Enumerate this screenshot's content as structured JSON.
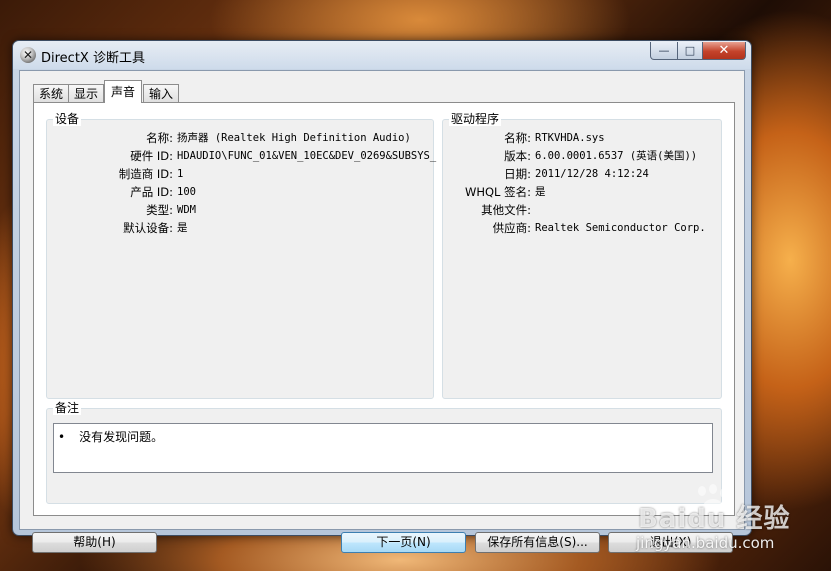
{
  "window": {
    "title": "DirectX 诊断工具",
    "controls": {
      "minimize": "—",
      "maximize": "□",
      "close": "✕"
    }
  },
  "tabs": [
    {
      "label": "系统",
      "active": false
    },
    {
      "label": "显示",
      "active": false
    },
    {
      "label": "声音",
      "active": true
    },
    {
      "label": "输入",
      "active": false
    }
  ],
  "device": {
    "title": "设备",
    "rows": [
      {
        "label": "名称:",
        "value": "扬声器 (Realtek High Definition Audio)"
      },
      {
        "label": "硬件 ID:",
        "value": "HDAUDIO\\FUNC_01&VEN_10EC&DEV_0269&SUBSYS_"
      },
      {
        "label": "制造商 ID:",
        "value": "1"
      },
      {
        "label": "产品 ID:",
        "value": "100"
      },
      {
        "label": "类型:",
        "value": "WDM"
      },
      {
        "label": "默认设备:",
        "value": "是"
      }
    ]
  },
  "driver": {
    "title": "驱动程序",
    "rows": [
      {
        "label": "名称:",
        "value": "RTKVHDA.sys"
      },
      {
        "label": "版本:",
        "value": "6.00.0001.6537 (英语(美国))"
      },
      {
        "label": "日期:",
        "value": "2011/12/28 4:12:24"
      },
      {
        "label": "WHQL 签名:",
        "value": "是"
      },
      {
        "label": "其他文件:",
        "value": ""
      },
      {
        "label": "供应商:",
        "value": "Realtek Semiconductor Corp."
      }
    ]
  },
  "notes": {
    "title": "备注",
    "bullet": "•",
    "text": "没有发现问题。"
  },
  "buttons": {
    "help": "帮助(H)",
    "next": "下一页(N)",
    "save": "保存所有信息(S)...",
    "exit": "退出(X)"
  },
  "watermark": {
    "brand": "Baidu 经验",
    "url": "jingyan.baidu.com"
  }
}
